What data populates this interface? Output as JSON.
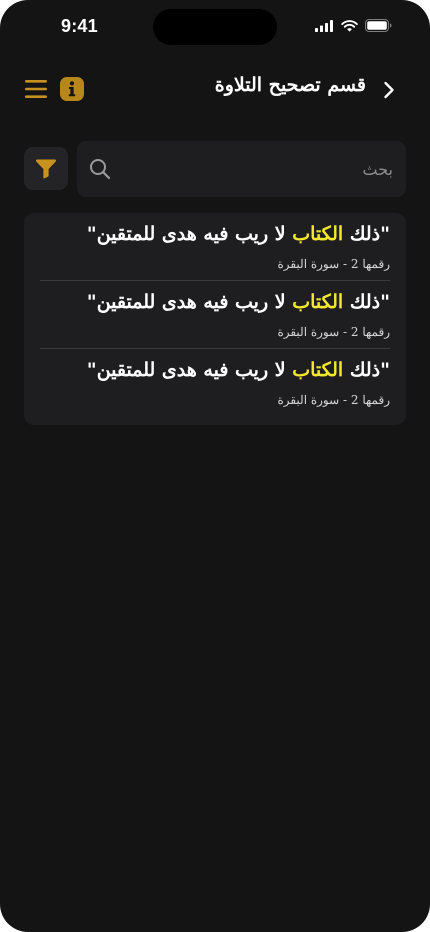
{
  "status_bar": {
    "time": "9:41"
  },
  "header": {
    "title": "قسم تصحيح التلاوة",
    "back_icon": "chevron-right-icon",
    "menu_icon": "hamburger-menu-icon",
    "info_icon": "info-icon"
  },
  "search": {
    "placeholder": "بحث",
    "value": "",
    "icon": "search-icon"
  },
  "filter": {
    "icon": "filter-funnel-icon"
  },
  "results": [
    {
      "quote_open": "\"",
      "before": "ذلك ",
      "highlight": "الكتاب",
      "after": " لا ريب فيه هدى للمتقين",
      "quote_close": "\"",
      "reference": "رقمها 2 - سورة البقرة"
    },
    {
      "quote_open": "\"",
      "before": "ذلك ",
      "highlight": "الكتاب",
      "after": " لا ريب فيه هدى للمتقين",
      "quote_close": "\"",
      "reference": "رقمها 2 - سورة البقرة"
    },
    {
      "quote_open": "\"",
      "before": "ذلك ",
      "highlight": "الكتاب",
      "after": " لا ريب فيه هدى للمتقين",
      "quote_close": "\"",
      "reference": "رقمها 2 - سورة البقرة"
    }
  ],
  "colors": {
    "background": "#141414",
    "surface": "#1e1e20",
    "accent": "#b88719",
    "highlight": "#f2e82c",
    "text": "#ffffff"
  }
}
